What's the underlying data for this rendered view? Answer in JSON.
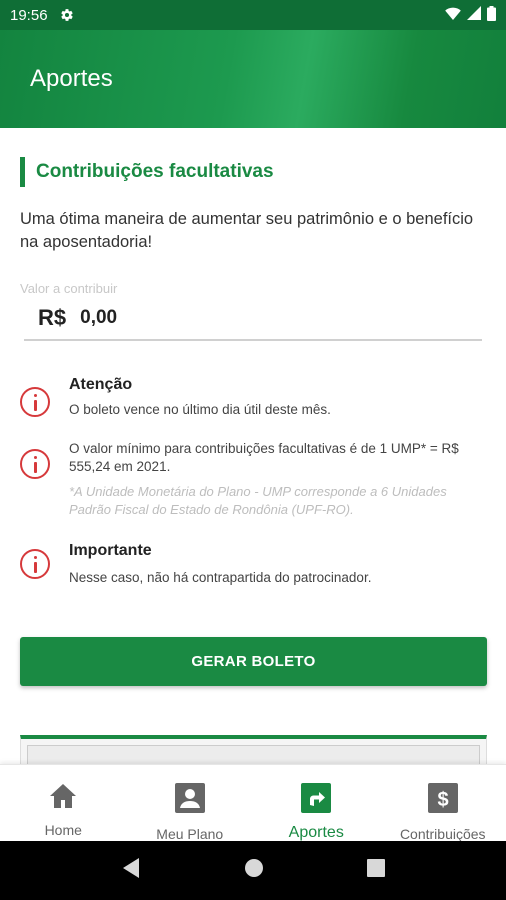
{
  "status_bar": {
    "time": "19:56",
    "icons": [
      "gear-icon",
      "wifi-icon",
      "signal-icon",
      "battery-icon"
    ]
  },
  "header": {
    "title": "Aportes"
  },
  "section": {
    "title": "Contribuições facultativas",
    "intro": "Uma ótima maneira de aumentar seu patrimônio e o benefício na aposentadoria!"
  },
  "value_input": {
    "label": "Valor a contribuir",
    "currency": "R$",
    "value": "0,00"
  },
  "notices": [
    {
      "icon": "alert-circle-icon",
      "title": "Atenção",
      "body": "O boleto vence no último dia útil deste mês."
    },
    {
      "icon": "alert-circle-icon",
      "body": "O valor mínimo para contribuições facultativas é de 1 UMP* = R$  555,24 em 2021.",
      "note": "*A Unidade Monetária do Plano - UMP corresponde a 6 Unidades Padrão Fiscal do Estado de Rondônia (UPF-RO)."
    },
    {
      "icon": "alert-circle-icon",
      "title": "Importante",
      "body": "Nesse caso, não há contrapartida do patrocinador."
    }
  ],
  "action": {
    "label": "GERAR BOLETO"
  },
  "bottom_nav": {
    "items": [
      {
        "label": "Home",
        "icon": "home-icon",
        "active": false
      },
      {
        "label": "Meu Plano",
        "icon": "person-icon",
        "active": false
      },
      {
        "label": "Aportes",
        "icon": "share-arrow-icon",
        "active": true
      },
      {
        "label": "Contribuições",
        "icon": "dollar-icon",
        "active": false
      }
    ]
  },
  "system_nav": [
    "back-icon",
    "home-circle-icon",
    "recents-icon"
  ],
  "colors": {
    "primary": "#1a8a43",
    "status_bar": "#0f6e36",
    "alert": "#d6393b"
  }
}
